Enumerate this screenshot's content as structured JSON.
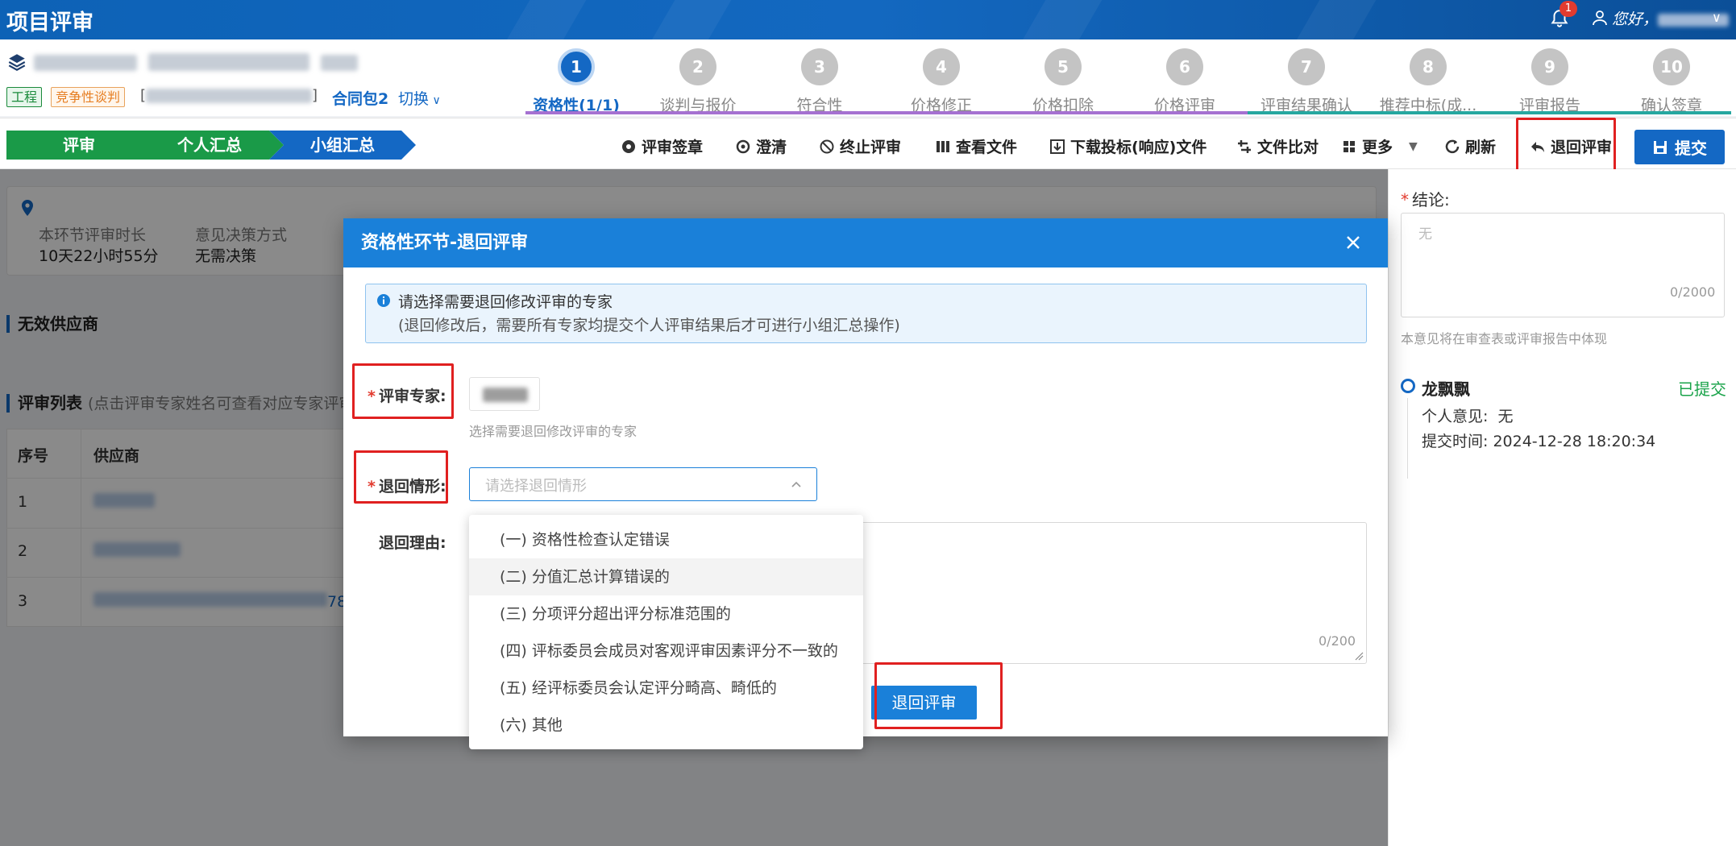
{
  "header": {
    "app_title": "项目评审",
    "notification_count": "1",
    "greeting": "您好，"
  },
  "project": {
    "tag_engineering": "工程",
    "tag_method": "竞争性谈判",
    "bracket_left": "[",
    "bracket_right": "]",
    "package": "合同包2",
    "switch_label": "切换"
  },
  "steps": [
    {
      "num": "1",
      "label": "资格性(1/1)",
      "active": true
    },
    {
      "num": "2",
      "label": "谈判与报价"
    },
    {
      "num": "3",
      "label": "符合性"
    },
    {
      "num": "4",
      "label": "价格修正"
    },
    {
      "num": "5",
      "label": "价格扣除"
    },
    {
      "num": "6",
      "label": "价格评审"
    },
    {
      "num": "7",
      "label": "评审结果确认"
    },
    {
      "num": "8",
      "label": "推荐中标(成..."
    },
    {
      "num": "9",
      "label": "评审报告"
    },
    {
      "num": "10",
      "label": "确认签章"
    }
  ],
  "nav_tabs": [
    "评审",
    "个人汇总",
    "小组汇总"
  ],
  "toolbar": {
    "sign": "评审签章",
    "clarify": "澄清",
    "stop": "终止评审",
    "view_files": "查看文件",
    "download": "下载投标(响应)文件",
    "compare": "文件比对",
    "more": "更多",
    "refresh": "刷新",
    "return_review": "退回评审",
    "submit": "提交"
  },
  "info": {
    "duration_label": "本环节评审时长",
    "duration_value": "10天22小时55分",
    "decision_label": "意见决策方式",
    "decision_value": "无需决策"
  },
  "invalid_suppliers_title": "无效供应商",
  "review_list": {
    "title": "评审列表",
    "hint": "(点击评审专家姓名可查看对应专家评审",
    "col_no": "序号",
    "col_supplier": "供应商",
    "rows": [
      "1",
      "2",
      "3"
    ],
    "row3_suffix": "78"
  },
  "right_panel": {
    "conclusion_label": "结论:",
    "conclusion_placeholder": "无",
    "conclusion_count": "0/2000",
    "conclusion_note": "本意见将在审查表或评审报告中体现",
    "expert_name": "龙飘飘",
    "expert_status": "已提交",
    "opinion_label": "个人意见:",
    "opinion_value": "无",
    "time_label": "提交时间:",
    "time_value": "2024-12-28 18:20:34"
  },
  "modal": {
    "title": "资格性环节-退回评审",
    "alert_line1": "请选择需要退回修改评审的专家",
    "alert_line2": "(退回修改后，需要所有专家均提交个人评审结果后才可进行小组汇总操作)",
    "expert_label": "评审专家:",
    "expert_hint": "选择需要退回修改评审的专家",
    "situation_label": "退回情形:",
    "situation_placeholder": "请选择退回情形",
    "reason_label": "退回理由:",
    "reason_count": "0/200",
    "confirm": "退回评审",
    "options": [
      "(一) 资格性检查认定错误",
      "(二) 分值汇总计算错误的",
      "(三) 分项评分超出评分标准范围的",
      "(四) 评标委员会成员对客观评审因素评分不一致的",
      "(五) 经评标委员会认定评分畸高、畸低的",
      "(六) 其他"
    ]
  },
  "colors": {
    "brand_blue": "#1468c4",
    "dialog_blue": "#1a80d9",
    "tab_green": "#1a9a48",
    "highlight_red": "#e02020"
  }
}
